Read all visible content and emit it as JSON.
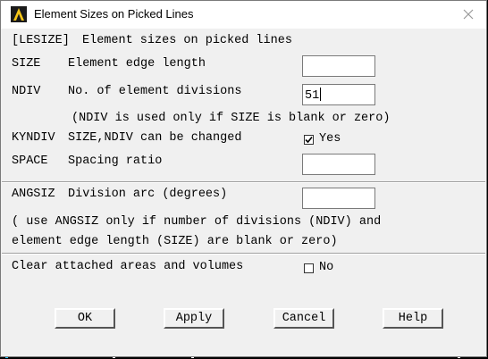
{
  "window": {
    "title": "Element Sizes on Picked Lines"
  },
  "header": {
    "code": "[LESIZE]",
    "description": "Element sizes on picked lines"
  },
  "fields": {
    "size": {
      "code": "SIZE",
      "label": "Element edge length",
      "value": ""
    },
    "ndiv": {
      "code": "NDIV",
      "label": "No. of element divisions",
      "value": "51"
    },
    "ndiv_note": "(NDIV is used only if SIZE is blank or zero)",
    "kyndiv": {
      "code": "KYNDIV",
      "label": "SIZE,NDIV can be changed",
      "option": "Yes",
      "checked": true
    },
    "space": {
      "code": "SPACE",
      "label": "Spacing ratio",
      "value": ""
    },
    "angsiz": {
      "code": "ANGSIZ",
      "label": "Division arc (degrees)",
      "value": ""
    },
    "angsiz_note_1": "( use ANGSIZ only if number of divisions (NDIV) and",
    "angsiz_note_2": "element edge length (SIZE) are blank or zero)",
    "clear": {
      "label": "Clear attached areas and volumes",
      "option": "No",
      "checked": false
    }
  },
  "buttons": {
    "ok": "OK",
    "apply": "Apply",
    "cancel": "Cancel",
    "help": "Help"
  },
  "icons": {
    "app": "ansys-logo-icon",
    "close": "close-icon",
    "check": "checkmark-icon"
  },
  "colors": {
    "dialog_bg": "#f0f0f0",
    "title_bg": "#ffffff",
    "app_icon_bg": "#1a1a1a",
    "app_icon_fg": "#f5c518"
  }
}
